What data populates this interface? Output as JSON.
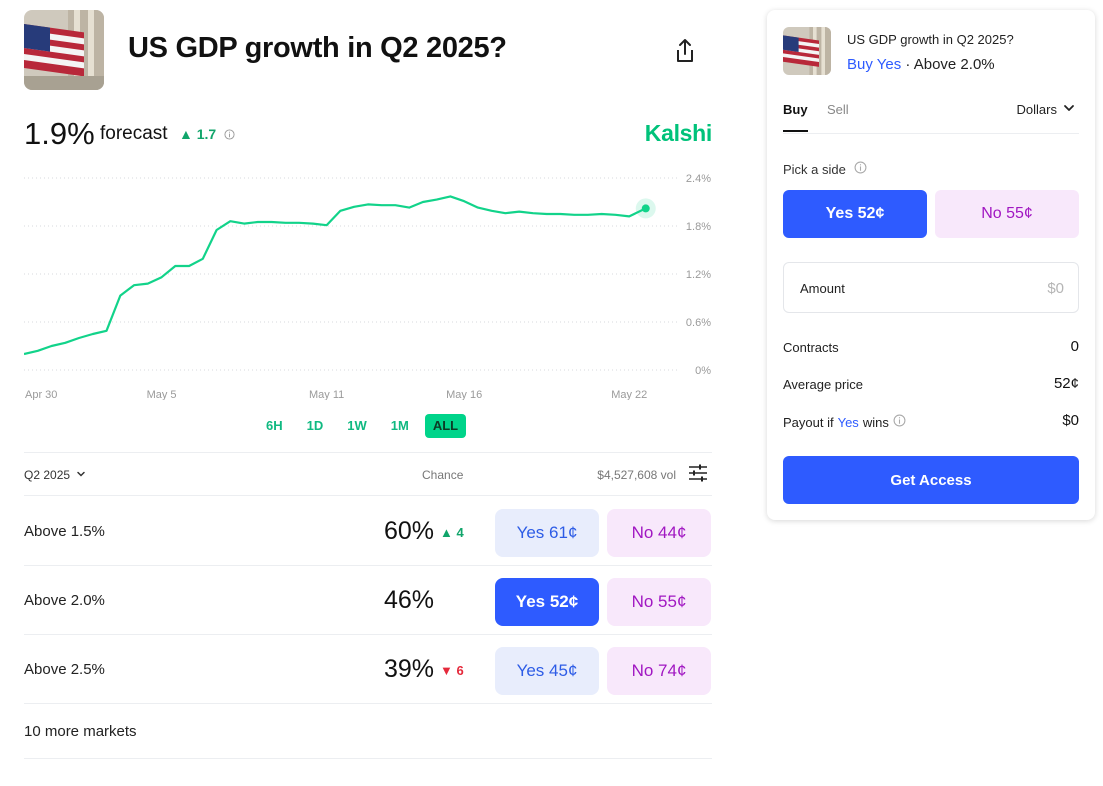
{
  "market": {
    "title": "US GDP growth in Q2 2025?",
    "image": "us-flag-stock-exchange-photo"
  },
  "forecast": {
    "value": "1.9%",
    "label": "forecast",
    "change": "1.7",
    "change_direction": "up"
  },
  "brand": "Kalshi",
  "colors": {
    "accent_green": "#00d48a",
    "line_green": "#12d38a",
    "yes_blue": "#2e5bff",
    "no_purple": "#a117c2",
    "up_green": "#11a56b",
    "down_red": "#e5293b"
  },
  "chart_data": {
    "type": "line",
    "series": [
      {
        "values": [
          [
            0.0,
            0.2
          ],
          [
            0.5,
            0.24
          ],
          [
            1.0,
            0.3
          ],
          [
            1.5,
            0.34
          ],
          [
            2.0,
            0.4
          ],
          [
            2.5,
            0.45
          ],
          [
            3.0,
            0.49
          ],
          [
            3.5,
            0.93
          ],
          [
            4.0,
            1.06
          ],
          [
            4.5,
            1.08
          ],
          [
            5.0,
            1.16
          ],
          [
            5.5,
            1.3
          ],
          [
            6.0,
            1.3
          ],
          [
            6.5,
            1.39
          ],
          [
            7.0,
            1.75
          ],
          [
            7.5,
            1.86
          ],
          [
            8.0,
            1.83
          ],
          [
            8.5,
            1.85
          ],
          [
            9.0,
            1.85
          ],
          [
            9.5,
            1.84
          ],
          [
            10.0,
            1.84
          ],
          [
            10.5,
            1.83
          ],
          [
            11.0,
            1.81
          ],
          [
            11.5,
            1.99
          ],
          [
            12.0,
            2.04
          ],
          [
            12.5,
            2.07
          ],
          [
            13.0,
            2.06
          ],
          [
            13.5,
            2.06
          ],
          [
            14.0,
            2.03
          ],
          [
            14.5,
            2.1
          ],
          [
            15.0,
            2.13
          ],
          [
            15.5,
            2.17
          ],
          [
            16.0,
            2.11
          ],
          [
            16.5,
            2.03
          ],
          [
            17.0,
            1.99
          ],
          [
            17.5,
            1.96
          ],
          [
            18.0,
            1.98
          ],
          [
            18.5,
            1.96
          ],
          [
            19.0,
            1.95
          ],
          [
            19.5,
            1.95
          ],
          [
            20.0,
            1.94
          ],
          [
            20.5,
            1.94
          ],
          [
            21.0,
            1.95
          ],
          [
            21.5,
            1.94
          ],
          [
            22.0,
            1.92
          ],
          [
            22.6,
            2.02
          ]
        ]
      }
    ],
    "x_ticks": [
      "Apr 30",
      "May 5",
      "May 11",
      "May 16",
      "May 22"
    ],
    "x_tick_positions": [
      0,
      5,
      11,
      16,
      22
    ],
    "xlim": [
      0,
      22.9
    ],
    "y_ticks": [
      "2.4%",
      "1.8%",
      "1.2%",
      "0.6%",
      "0%"
    ],
    "y_tick_values": [
      2.4,
      1.8,
      1.2,
      0.6,
      0
    ],
    "ylim": [
      0,
      2.4
    ],
    "grid": true,
    "grid_style": "dotted",
    "end_marker": true
  },
  "ranges": [
    "6H",
    "1D",
    "1W",
    "1M",
    "ALL"
  ],
  "active_range": "ALL",
  "table": {
    "period": "Q2 2025",
    "chance_header": "Chance",
    "volume": "$4,527,608 vol",
    "rows": [
      {
        "name": "Above 1.5%",
        "chance": "60%",
        "change": "4",
        "change_direction": "up",
        "yes": "Yes 61¢",
        "no": "No 44¢",
        "selected": false
      },
      {
        "name": "Above 2.0%",
        "chance": "46%",
        "change": "",
        "change_direction": "none",
        "yes": "Yes 52¢",
        "no": "No 55¢",
        "selected": true
      },
      {
        "name": "Above 2.5%",
        "chance": "39%",
        "change": "6",
        "change_direction": "down",
        "yes": "Yes 45¢",
        "no": "No 74¢",
        "selected": false
      }
    ],
    "more": "10 more markets"
  },
  "panel": {
    "title": "US GDP growth in Q2 2025?",
    "buy_label": "Buy Yes",
    "separator": " · ",
    "target": "Above 2.0%",
    "tabs": [
      "Buy",
      "Sell"
    ],
    "active_tab": "Buy",
    "currency": "Dollars",
    "pick_side": "Pick a side",
    "yes_button": "Yes 52¢",
    "no_button": "No 55¢",
    "amount_label": "Amount",
    "amount_placeholder": "$0",
    "contracts_label": "Contracts",
    "contracts_value": "0",
    "avg_price_label": "Average price",
    "avg_price_value": "52¢",
    "payout_prefix": "Payout if",
    "payout_side": "Yes",
    "payout_suffix": "wins",
    "payout_value": "$0",
    "cta": "Get Access"
  }
}
